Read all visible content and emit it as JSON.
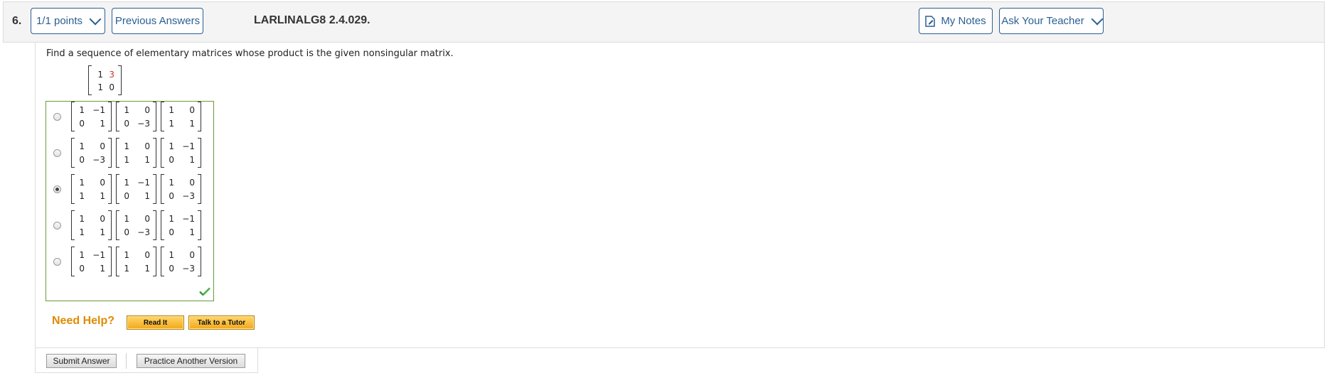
{
  "header": {
    "question_number": "6.",
    "points_label": "1/1 points",
    "previous_answers_label": "Previous Answers",
    "question_id": "LARLINALG8 2.4.029.",
    "my_notes_label": "My Notes",
    "ask_teacher_label": "Ask Your Teacher"
  },
  "question": {
    "prompt": "Find a sequence of elementary matrices whose product is the given nonsingular matrix.",
    "given_matrix": {
      "rows": [
        [
          "1",
          "3"
        ],
        [
          "1",
          "0"
        ]
      ],
      "highlight_color": "#c0392b"
    }
  },
  "choices": [
    {
      "selected": false,
      "matrices": [
        [
          [
            "1",
            "−1"
          ],
          [
            "0",
            "1"
          ]
        ],
        [
          [
            "1",
            "0"
          ],
          [
            "0",
            "−3"
          ]
        ],
        [
          [
            "1",
            "0"
          ],
          [
            "1",
            "1"
          ]
        ]
      ]
    },
    {
      "selected": false,
      "matrices": [
        [
          [
            "1",
            "0"
          ],
          [
            "0",
            "−3"
          ]
        ],
        [
          [
            "1",
            "0"
          ],
          [
            "1",
            "1"
          ]
        ],
        [
          [
            "1",
            "−1"
          ],
          [
            "0",
            "1"
          ]
        ]
      ]
    },
    {
      "selected": true,
      "matrices": [
        [
          [
            "1",
            "0"
          ],
          [
            "1",
            "1"
          ]
        ],
        [
          [
            "1",
            "−1"
          ],
          [
            "0",
            "1"
          ]
        ],
        [
          [
            "1",
            "0"
          ],
          [
            "0",
            "−3"
          ]
        ]
      ]
    },
    {
      "selected": false,
      "matrices": [
        [
          [
            "1",
            "0"
          ],
          [
            "1",
            "1"
          ]
        ],
        [
          [
            "1",
            "0"
          ],
          [
            "0",
            "−3"
          ]
        ],
        [
          [
            "1",
            "−1"
          ],
          [
            "0",
            "1"
          ]
        ]
      ]
    },
    {
      "selected": false,
      "matrices": [
        [
          [
            "1",
            "−1"
          ],
          [
            "0",
            "1"
          ]
        ],
        [
          [
            "1",
            "0"
          ],
          [
            "1",
            "1"
          ]
        ],
        [
          [
            "1",
            "0"
          ],
          [
            "0",
            "−3"
          ]
        ]
      ]
    }
  ],
  "result_icon": "checkmark-icon",
  "help": {
    "label": "Need Help?",
    "read_it_label": "Read It",
    "tutor_label": "Talk to a Tutor"
  },
  "footer": {
    "submit_label": "Submit Answer",
    "practice_label": "Practice Another Version"
  },
  "colors": {
    "accent": "#2b5f93",
    "correct": "#6a9b3a",
    "help": "#e08a00"
  }
}
